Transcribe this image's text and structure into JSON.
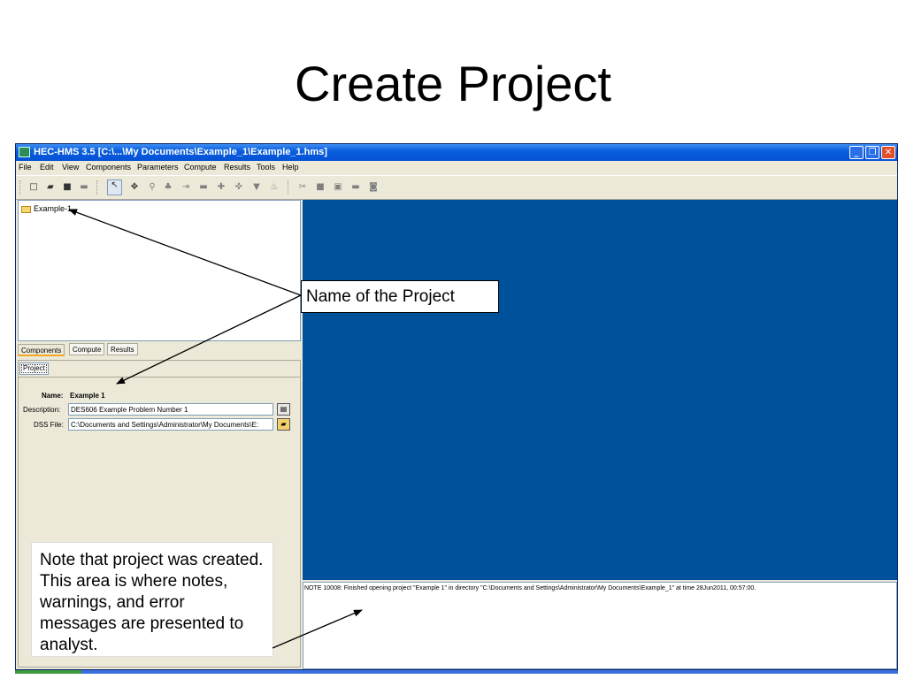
{
  "slide": {
    "title": "Create Project"
  },
  "window": {
    "title": "HEC-HMS 3.5 [C:\\...\\My Documents\\Example_1\\Example_1.hms]",
    "controls": {
      "minimize": "_",
      "maximize": "❐",
      "close": "✕"
    }
  },
  "menu": {
    "items": [
      "File",
      "Edit",
      "View",
      "Components",
      "Parameters",
      "Compute",
      "Results",
      "Tools",
      "Help"
    ]
  },
  "toolbar": {
    "icons": [
      "new-icon",
      "open-icon",
      "save-icon",
      "print-icon",
      "arrow-select-icon",
      "pan-icon",
      "zoom-icon",
      "subbasin-icon",
      "reach-icon",
      "reservoir-icon",
      "junction-icon",
      "diversion-icon",
      "source-icon",
      "sink-icon",
      "compute-icon",
      "results-graph-icon",
      "results-summary-icon",
      "results-table-icon",
      "message-icon"
    ]
  },
  "tree": {
    "root_label": "Example-1"
  },
  "tabs": {
    "components": "Components",
    "compute": "Compute",
    "results": "Results"
  },
  "properties": {
    "tab_label": "Project",
    "name_label": "Name:",
    "name_value": "Example 1",
    "description_label": "Description:",
    "description_value": "DES606 Example Problem Number 1",
    "dss_label": "DSS File:",
    "dss_value": "C:\\Documents and Settings\\Administrator\\My Documents\\E:"
  },
  "messages": {
    "line1": "NOTE 10008:  Finished opening project \"Example 1\" in directory \"C:\\Documents and Settings\\Administrator\\My Documents\\Example_1\" at time 28Jun2011, 00:57:00."
  },
  "callouts": {
    "project_name": "Name of the Project",
    "note": "Note that project was created.  This area is where notes, warnings, and error messages are presented to analyst."
  },
  "colors": {
    "canvas_background": "#00519c",
    "titlebar": "#0a5fdc",
    "window_face": "#ece9d8"
  }
}
